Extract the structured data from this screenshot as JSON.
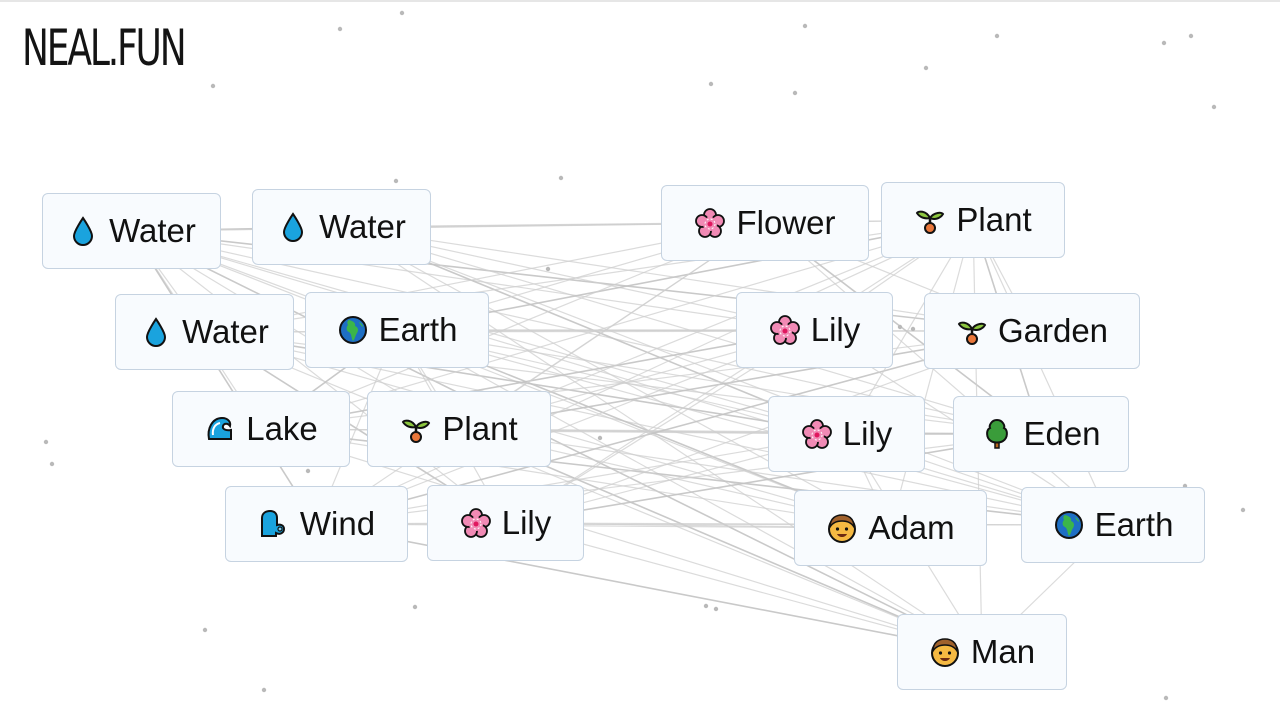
{
  "app": {
    "logo": "NEAL.FUN"
  },
  "colors": {
    "node_bg": "#f8fbfe",
    "node_border": "#c6d3e1",
    "line": "#cfcfcf",
    "water": "#1aa3de",
    "earth_blue": "#1e6fc4",
    "earth_green": "#3bb54a",
    "flower_pink": "#f18ab5",
    "sprout_green": "#8cc63f",
    "sprout_seed": "#e9773b",
    "tree_green": "#3a9c3a",
    "face_skin": "#f5b942"
  },
  "canvas": {
    "elements": [
      {
        "label": "Water",
        "icon": "water-drop"
      },
      {
        "label": "Water",
        "icon": "water-drop"
      },
      {
        "label": "Water",
        "icon": "water-drop"
      },
      {
        "label": "Earth",
        "icon": "globe"
      },
      {
        "label": "Lake",
        "icon": "wave"
      },
      {
        "label": "Plant",
        "icon": "seedling"
      },
      {
        "label": "Wind",
        "icon": "wind-face"
      },
      {
        "label": "Lily",
        "icon": "cherry-blossom"
      },
      {
        "label": "Flower",
        "icon": "cherry-blossom"
      },
      {
        "label": "Plant",
        "icon": "seedling"
      },
      {
        "label": "Lily",
        "icon": "cherry-blossom"
      },
      {
        "label": "Garden",
        "icon": "seedling"
      },
      {
        "label": "Lily",
        "icon": "cherry-blossom"
      },
      {
        "label": "Eden",
        "icon": "tree"
      },
      {
        "label": "Adam",
        "icon": "man-face"
      },
      {
        "label": "Earth",
        "icon": "globe"
      },
      {
        "label": "Man",
        "icon": "man-face"
      }
    ]
  }
}
